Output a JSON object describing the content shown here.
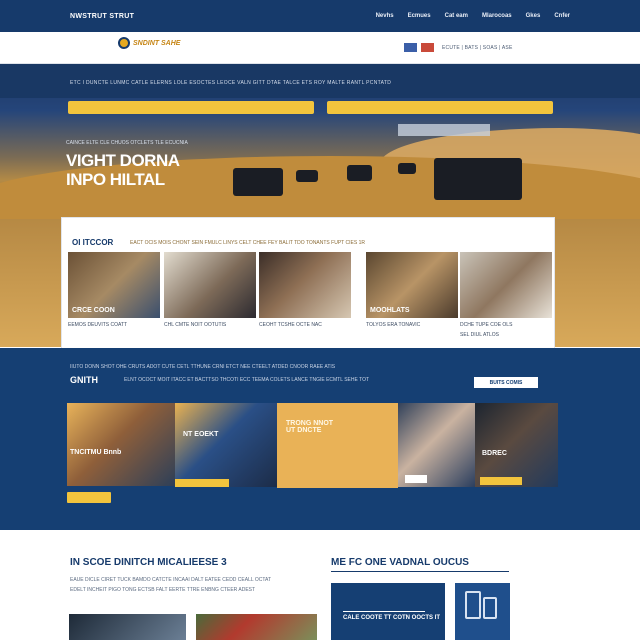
{
  "topnav": {
    "brand": "NWSTRUT STRUT",
    "links": [
      "Nevhs",
      "Ecmues",
      "Cat eam",
      "Mlarocoas",
      "Gkes",
      "Cnfer"
    ]
  },
  "logo": {
    "text": "SNDINT SAHE"
  },
  "utility": {
    "langs": "ECUTE | BATS | SOAS | ASE"
  },
  "hero": {
    "crumb": "ETC I  DUNCTE LUNMC CATLE ELERNS LOLE ESOCTES LEOCE VALN GITT DTAE TALCE ETS ROY MALTE RANTL PCNTATD",
    "caption": "CAINCE ELTE CLE CHUOS OTCLETS TLE ECUCNIA",
    "title": "VIGHT DORNA INPO HILTAL"
  },
  "news": {
    "head": "OI ITCCOR",
    "sub": "EACT OCIS MOIS CHONT SEIN FMULC LINYS CELT CHEE FEY BALIT TDO TONANTS FUPT CIES 1R",
    "cards": [
      {
        "label": "CRCE COON",
        "cap": "EEMOS DEUVITS COATT",
        "cap2": ""
      },
      {
        "label": "",
        "cap": "CHL CMTE NOIT OOTUTIS",
        "cap2": ""
      },
      {
        "label": "",
        "cap": "CEOHT TCSHE OCTE NAC",
        "cap2": ""
      },
      {
        "label": "MOOHLATS",
        "cap": "TOLYOS ERA TONAVIC",
        "cap2": ""
      },
      {
        "label": "",
        "cap": "DCHE TUPE COE OLS",
        "cap2": "SEL DIUL ATLOS"
      }
    ]
  },
  "blue": {
    "intro": "IIUTO DONN SHOT OHE CRUTS ADOT CUTE CETL TTHUNE CRNI ETCT NEE CTEELT ATDED CNOOR RAEE ATIS",
    "heading": "GNITH",
    "intro2": "ELNT OCOCT MOIT ITACC ET BACTTSO THCOTI ECC TEEMA COLETS LANCE TNGIE ECMTL SEHE TOT",
    "more": "BUITS COMIS",
    "tiles": [
      {
        "text": "TNCITMU Bnnb"
      },
      {
        "text": "NT EOEKT"
      },
      {
        "text": "TRONG NNOT\nUT DNCTE"
      },
      {
        "text": ""
      },
      {
        "text": "BDREC"
      }
    ]
  },
  "lower": {
    "heading": "IN SCOE DINITCH MICALIEESE 3",
    "sub1": "EAUE DICLE CIRET TUCK BAMDO CATCTE INCAAI DALT EATEE CEDD CEALL OCTAT",
    "sub2": "EDELT INCHEIT PIGO TONG ECTSB FALT EERTE TTRE ENBNG CTEER ADEST",
    "heading2": "ME FC ONE VADNAL OUCUS",
    "promo": "CALE COOTE TT COTN OOCTS IT"
  },
  "colors": {
    "navy": "#163a6b",
    "gold": "#f2c43d",
    "sand": "#c08c3c"
  }
}
